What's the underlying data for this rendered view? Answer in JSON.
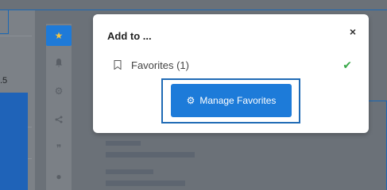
{
  "background": {
    "value_label": ".5"
  },
  "modal": {
    "title": "Add to ...",
    "close_symbol": "×",
    "favorites_label": "Favorites (1)",
    "check_symbol": "✔",
    "manage_label": "Manage Favorites"
  },
  "toolbar": {
    "items": [
      {
        "name": "star-icon",
        "glyph": "★",
        "active": true
      },
      {
        "name": "bell-icon",
        "glyph": "🔔",
        "active": false
      },
      {
        "name": "gear-icon",
        "glyph": "⚙",
        "active": false
      },
      {
        "name": "share-icon",
        "glyph": "<",
        "active": false
      },
      {
        "name": "quote-icon",
        "glyph": "❞",
        "active": false
      },
      {
        "name": "comment-icon",
        "glyph": "●",
        "active": false
      }
    ]
  },
  "colors": {
    "accent": "#1d7bd9",
    "check": "#3aa94a",
    "star": "#f4c542"
  }
}
